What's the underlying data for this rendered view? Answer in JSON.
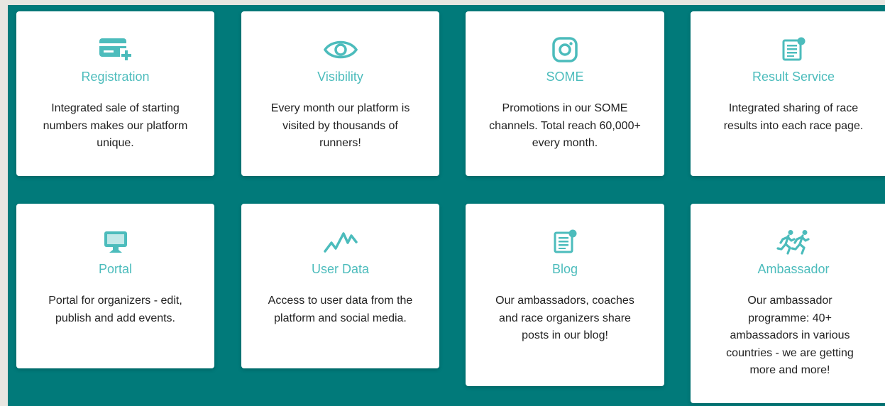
{
  "accent_color": "#4cbcbc",
  "panel_color": "#017a7a",
  "features": [
    {
      "icon": "credit-card-add-icon",
      "title": "Registration",
      "description": "Integrated sale of starting numbers makes our platform unique."
    },
    {
      "icon": "eye-icon",
      "title": "Visibility",
      "description": "Every month our platform is visited by thousands of runners!"
    },
    {
      "icon": "instagram-icon",
      "title": "SOME",
      "description": "Promotions in our SOME channels. Total reach 60,000+ every month."
    },
    {
      "icon": "newsletter-icon",
      "title": "Result Service",
      "description": "Integrated sharing of race results into each race page."
    },
    {
      "icon": "monitor-icon",
      "title": "Portal",
      "description": "Portal for organizers - edit, publish and add events."
    },
    {
      "icon": "activity-line-icon",
      "title": "User Data",
      "description": "Access to user data from the platform and social media."
    },
    {
      "icon": "newsletter-icon",
      "title": "Blog",
      "description": "Our ambassadors, coaches and race organizers share posts in our blog!"
    },
    {
      "icon": "runners-icon",
      "title": "Ambassador",
      "description": "Our ambassador programme: 40+ ambassadors in various countries - we are getting more and more!"
    }
  ]
}
